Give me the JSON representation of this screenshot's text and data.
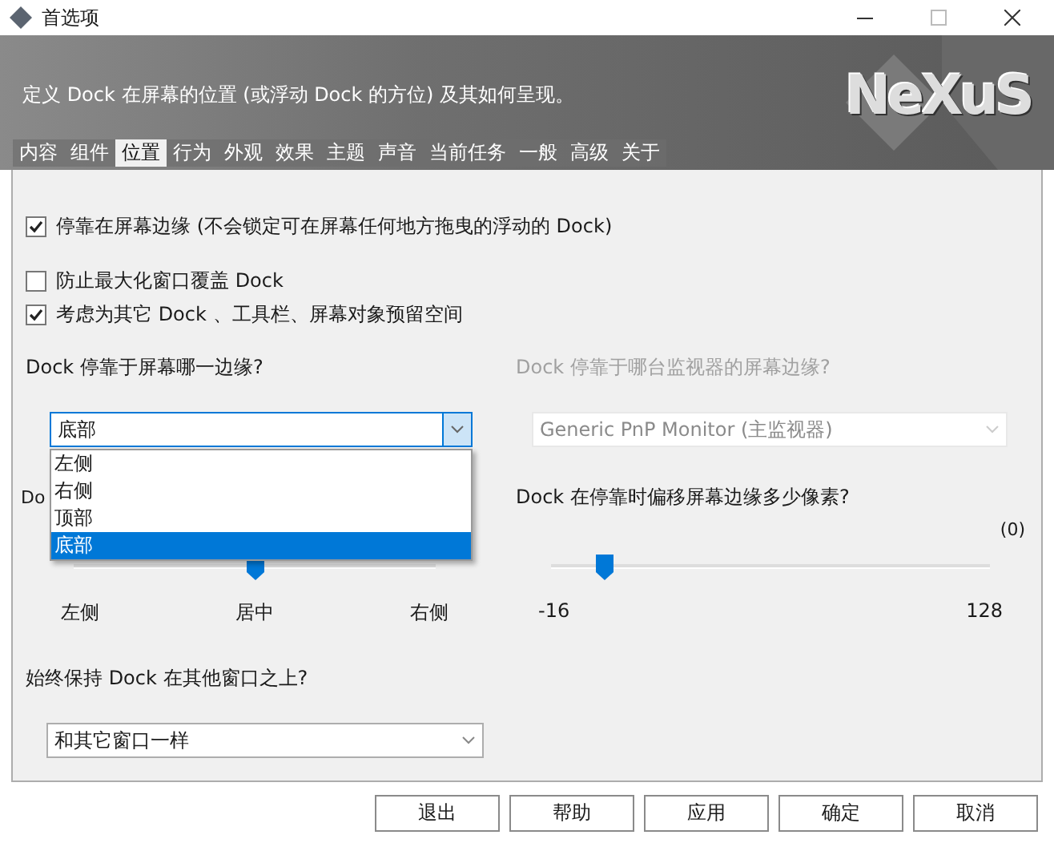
{
  "window": {
    "title": "首选项"
  },
  "banner": {
    "description": "定义 Dock 在屏幕的位置 (或浮动 Dock 的方位) 及其如何呈现。",
    "logo": "NeXuS"
  },
  "tabs": [
    {
      "label": "内容",
      "selected": false
    },
    {
      "label": "组件",
      "selected": false
    },
    {
      "label": "位置",
      "selected": true
    },
    {
      "label": "行为",
      "selected": false
    },
    {
      "label": "外观",
      "selected": false
    },
    {
      "label": "效果",
      "selected": false
    },
    {
      "label": "主题",
      "selected": false
    },
    {
      "label": "声音",
      "selected": false
    },
    {
      "label": "当前任务",
      "selected": false
    },
    {
      "label": "一般",
      "selected": false
    },
    {
      "label": "高级",
      "selected": false
    },
    {
      "label": "关于",
      "selected": false
    }
  ],
  "options": [
    {
      "label": "停靠在屏幕边缘 (不会锁定可在屏幕任何地方拖曳的浮动的 Dock)",
      "checked": true
    },
    {
      "label": "防止最大化窗口覆盖 Dock",
      "checked": false
    },
    {
      "label": "考虑为其它 Dock 、工具栏、屏幕对象预留空间",
      "checked": true
    }
  ],
  "edge": {
    "label": "Dock 停靠于屏幕哪一边缘?",
    "value": "底部",
    "expanded": true,
    "items": [
      {
        "label": "左侧",
        "selected": false
      },
      {
        "label": "右侧",
        "selected": false
      },
      {
        "label": "顶部",
        "selected": false
      },
      {
        "label": "底部",
        "selected": true
      }
    ]
  },
  "monitor": {
    "label": "Dock 停靠于哪台监视器的屏幕边缘?",
    "value": "Generic PnP Monitor (主监视器)",
    "disabled": true
  },
  "center_slider": {
    "label": "Do",
    "level": 0.5,
    "tick_labels": [
      "左侧",
      "居中",
      "右侧"
    ]
  },
  "offset_slider": {
    "label": "Dock 在停靠时偏移屏幕边缘多少像素?",
    "reading": "(0)",
    "level": 0.12,
    "tick_labels": [
      "-16",
      "128"
    ]
  },
  "on_top": {
    "label": "始终保持 Dock 在其他窗口之上?",
    "value": "和其它窗口一样"
  },
  "buttons": [
    "退出",
    "帮助",
    "应用",
    "确定",
    "取消"
  ]
}
